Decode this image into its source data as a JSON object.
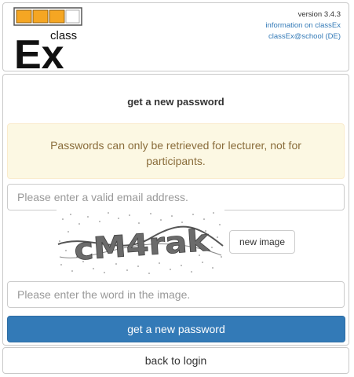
{
  "header": {
    "logo_small_text": "class",
    "logo_big_text": "Ex",
    "version": "version 3.4.3",
    "info_link": "information on classEx",
    "school_link": "classEx@school (DE)"
  },
  "form": {
    "title": "get a new password",
    "alert": "Passwords can only be retrieved for lecturer, not for participants.",
    "email_placeholder": "Please enter a valid email address.",
    "captcha_text": "cM4rak",
    "new_image_label": "new image",
    "word_placeholder": "Please enter the word in the image.",
    "submit_label": "get a new password"
  },
  "footer": {
    "back_label": "back to login"
  },
  "colors": {
    "primary": "#337ab7",
    "warning_bg": "#fcf8e3",
    "warning_text": "#8a6d3b",
    "logo_orange": "#f5a623"
  }
}
